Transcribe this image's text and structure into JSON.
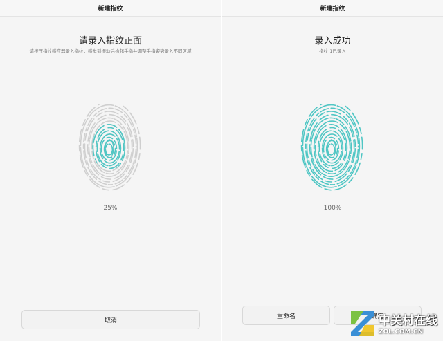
{
  "left_panel": {
    "title": "新建指纹",
    "heading": "请录入指纹正面",
    "instruction": "请按压指纹感应器录入指纹，感觉到振动后抬起手指并调整手指姿势录入不同区域",
    "progress": "25%",
    "progress_value": 0.25,
    "cancel_label": "取消"
  },
  "right_panel": {
    "title": "新建指纹",
    "heading": "录入成功",
    "subtitle": "指纹 1已录入",
    "progress": "100%",
    "progress_value": 1.0,
    "rename_label": "重命名",
    "confirm_label": "确定"
  },
  "watermark": {
    "text_cn": "中关村在线",
    "text_en": "ZOL.COM.CN"
  },
  "colors": {
    "accent": "#4fc6c4",
    "inactive_ridge": "#cfcfcf",
    "background": "#f5f5f5"
  },
  "icons": {
    "fingerprint": "fingerprint-icon",
    "watermark_logo": "zol-logo"
  }
}
